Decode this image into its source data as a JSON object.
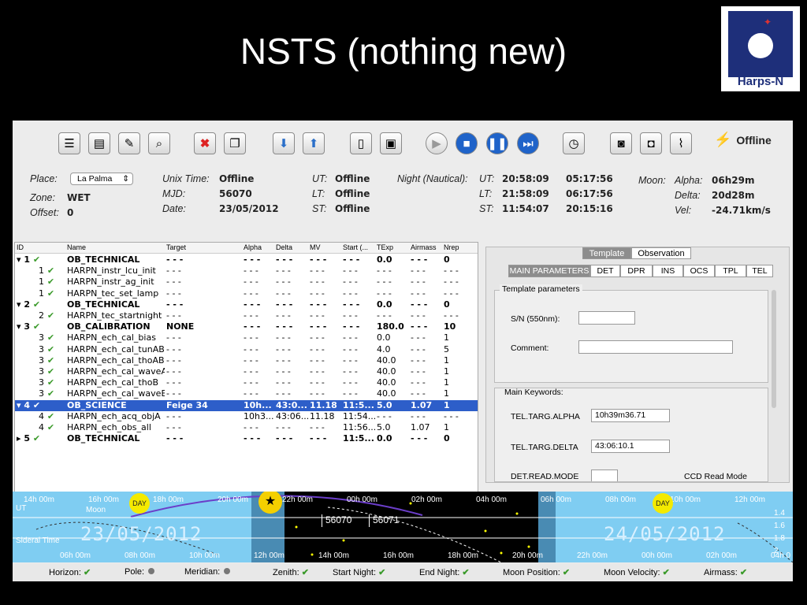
{
  "slide": {
    "title": "NSTS (nothing new)"
  },
  "logo": {
    "text": "Harps-N"
  },
  "app": {
    "connection_status": "Offline",
    "info": {
      "place_label": "Place:",
      "place_value": "La Palma",
      "zone_label": "Zone:",
      "zone_value": "WET",
      "offset_label": "Offset:",
      "offset_value": "0",
      "unix_label": "Unix Time:",
      "unix_value": "Offline",
      "mjd_label": "MJD:",
      "mjd_value": "56070",
      "date_label": "Date:",
      "date_value": "23/05/2012",
      "ut_label": "UT:",
      "ut_value": "Offline",
      "lt_label": "LT:",
      "lt_value": "Offline",
      "st_label": "ST:",
      "st_value": "Offline",
      "night_label": "Night (Nautical):",
      "n_ut_label": "UT:",
      "n_ut_start": "20:58:09",
      "n_ut_end": "05:17:56",
      "n_lt_label": "LT:",
      "n_lt_start": "21:58:09",
      "n_lt_end": "06:17:56",
      "n_st_label": "ST:",
      "n_st_start": "11:54:07",
      "n_st_end": "20:15:16",
      "moon_label": "Moon:",
      "alpha_label": "Alpha:",
      "alpha_value": "06h29m",
      "delta_label": "Delta:",
      "delta_value": "20d28m",
      "vel_label": "Vel:",
      "vel_value": "-24.71km/s"
    },
    "table": {
      "headers": [
        "ID",
        "Name",
        "Target",
        "Alpha",
        "Delta",
        "MV",
        "Start (...",
        "TExp",
        "Airmass",
        "Nrep"
      ],
      "rows": [
        {
          "id": "1",
          "name": "OB_TECHNICAL",
          "target": "- - -",
          "alpha": "- - -",
          "delta": "- - -",
          "mv": "- - -",
          "start": "- - -",
          "texp": "0.0",
          "airmass": "- - -",
          "nrep": "0"
        },
        {
          "id": "1",
          "name": "HARPN_instr_lcu_init",
          "target": "- - -",
          "alpha": "- - -",
          "delta": "- - -",
          "mv": "- - -",
          "start": "- - -",
          "texp": "- - -",
          "airmass": "- - -",
          "nrep": "- - -"
        },
        {
          "id": "1",
          "name": "HARPN_instr_ag_init",
          "target": "- - -",
          "alpha": "- - -",
          "delta": "- - -",
          "mv": "- - -",
          "start": "- - -",
          "texp": "- - -",
          "airmass": "- - -",
          "nrep": "- - -"
        },
        {
          "id": "1",
          "name": "HARPN_tec_set_lamp",
          "target": "- - -",
          "alpha": "- - -",
          "delta": "- - -",
          "mv": "- - -",
          "start": "- - -",
          "texp": "- - -",
          "airmass": "- - -",
          "nrep": "- - -"
        },
        {
          "id": "2",
          "name": "OB_TECHNICAL",
          "target": "- - -",
          "alpha": "- - -",
          "delta": "- - -",
          "mv": "- - -",
          "start": "- - -",
          "texp": "0.0",
          "airmass": "- - -",
          "nrep": "0"
        },
        {
          "id": "2",
          "name": "HARPN_tec_startnight",
          "target": "- - -",
          "alpha": "- - -",
          "delta": "- - -",
          "mv": "- - -",
          "start": "- - -",
          "texp": "- - -",
          "airmass": "- - -",
          "nrep": "- - -"
        },
        {
          "id": "3",
          "name": "OB_CALIBRATION",
          "target": "NONE",
          "alpha": "- - -",
          "delta": "- - -",
          "mv": "- - -",
          "start": "- - -",
          "texp": "180.0",
          "airmass": "- - -",
          "nrep": "10"
        },
        {
          "id": "3",
          "name": "HARPN_ech_cal_bias",
          "target": "- - -",
          "alpha": "- - -",
          "delta": "- - -",
          "mv": "- - -",
          "start": "- - -",
          "texp": "0.0",
          "airmass": "- - -",
          "nrep": "1"
        },
        {
          "id": "3",
          "name": "HARPN_ech_cal_tunAB",
          "target": "- - -",
          "alpha": "- - -",
          "delta": "- - -",
          "mv": "- - -",
          "start": "- - -",
          "texp": "4.0",
          "airmass": "- - -",
          "nrep": "5"
        },
        {
          "id": "3",
          "name": "HARPN_ech_cal_thoAB",
          "target": "- - -",
          "alpha": "- - -",
          "delta": "- - -",
          "mv": "- - -",
          "start": "- - -",
          "texp": "40.0",
          "airmass": "- - -",
          "nrep": "1"
        },
        {
          "id": "3",
          "name": "HARPN_ech_cal_waveAB",
          "target": "- - -",
          "alpha": "- - -",
          "delta": "- - -",
          "mv": "- - -",
          "start": "- - -",
          "texp": "40.0",
          "airmass": "- - -",
          "nrep": "1"
        },
        {
          "id": "3",
          "name": "HARPN_ech_cal_thoB",
          "target": "- - -",
          "alpha": "- - -",
          "delta": "- - -",
          "mv": "- - -",
          "start": "- - -",
          "texp": "40.0",
          "airmass": "- - -",
          "nrep": "1"
        },
        {
          "id": "3",
          "name": "HARPN_ech_cal_waveB",
          "target": "- - -",
          "alpha": "- - -",
          "delta": "- - -",
          "mv": "- - -",
          "start": "- - -",
          "texp": "40.0",
          "airmass": "- - -",
          "nrep": "1"
        },
        {
          "id": "4",
          "name": "OB_SCIENCE",
          "target": "Feige 34",
          "alpha": "10h...",
          "delta": "43:0...",
          "mv": "11.18",
          "start": "11:5...",
          "texp": "5.0",
          "airmass": "1.07",
          "nrep": "1"
        },
        {
          "id": "4",
          "name": "HARPN_ech_acq_objA",
          "target": "- - -",
          "alpha": "10h3...",
          "delta": "43:06...",
          "mv": "11.18",
          "start": "11:54...",
          "texp": "- - -",
          "airmass": "- - -",
          "nrep": "- - -"
        },
        {
          "id": "4",
          "name": "HARPN_ech_obs_all",
          "target": "- - -",
          "alpha": "- - -",
          "delta": "- - -",
          "mv": "- - -",
          "start": "11:56...",
          "texp": "5.0",
          "airmass": "1.07",
          "nrep": "1"
        },
        {
          "id": "5",
          "name": "OB_TECHNICAL",
          "target": "- - -",
          "alpha": "- - -",
          "delta": "- - -",
          "mv": "- - -",
          "start": "11:5...",
          "texp": "0.0",
          "airmass": "- - -",
          "nrep": "0"
        }
      ]
    },
    "right_panel": {
      "tabs": [
        "Template",
        "Observation"
      ],
      "subtabs": [
        "MAIN PARAMETERS",
        "DET",
        "DPR",
        "INS",
        "OCS",
        "TPL",
        "TEL"
      ],
      "template_group": "Template parameters",
      "sn_label": "S/N (550nm):",
      "sn_value": "",
      "comment_label": "Comment:",
      "comment_value": "",
      "keywords_group": "Main Keywords:",
      "alpha_kw_label": "TEL.TARG.ALPHA",
      "alpha_kw_value": "10h39m36.71",
      "delta_kw_label": "TEL.TARG.DELTA",
      "delta_kw_value": "43:06:10.1",
      "det_read_label": "DET.READ.MODE",
      "ccd_read_label": "CCD Read Mode"
    },
    "timeline": {
      "top_hours": [
        "14h 00m",
        "16h 00m",
        "18h 00m",
        "20h 00m",
        "22h 00m",
        "00h 00m",
        "02h 00m",
        "04h 00m",
        "06h 00m",
        "08h 00m",
        "10h 00m",
        "12h 00m"
      ],
      "bottom_hours": [
        "06h 00m",
        "08h 00m",
        "10h 00m",
        "12h 00m",
        "14h 00m",
        "16h 00m",
        "18h 00m",
        "20h 00m",
        "22h 00m",
        "00h 00m",
        "02h 00m",
        "04h 0"
      ],
      "ut_label": "UT",
      "moon_label": "Moon",
      "sidereal_label": "Sideral Time",
      "date_left": "23/05/2012",
      "date_right": "24/05/2012",
      "mjd_left": "56070",
      "mjd_right": "56071",
      "day_label": "DAY",
      "airmass_scale": [
        "1.4",
        "1.6",
        "1.8",
        "2"
      ]
    },
    "statusbar": [
      {
        "label": "Horizon:",
        "state": "ok"
      },
      {
        "label": "Pole:",
        "state": "off"
      },
      {
        "label": "Meridian:",
        "state": "off"
      },
      {
        "label": "Zenith:",
        "state": "ok"
      },
      {
        "label": "Start Night:",
        "state": "ok"
      },
      {
        "label": "End Night:",
        "state": "ok"
      },
      {
        "label": "Moon Position:",
        "state": "ok"
      },
      {
        "label": "Moon Velocity:",
        "state": "ok"
      },
      {
        "label": "Airmass:",
        "state": "ok"
      }
    ]
  }
}
